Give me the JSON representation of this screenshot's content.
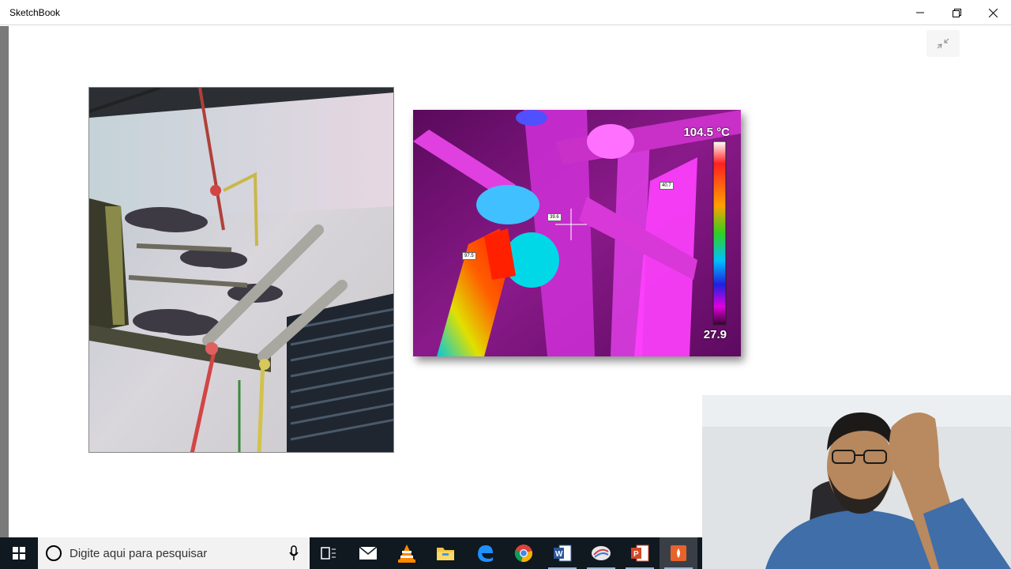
{
  "window": {
    "title": "SketchBook"
  },
  "thermal": {
    "max_label": "104.5 °C",
    "min_label": "27.9",
    "tags": [
      "97.5",
      "39.6",
      "40.7"
    ]
  },
  "taskbar": {
    "search_placeholder": "Digite aqui para pesquisar"
  },
  "icons": {
    "minimize": "minimize-icon",
    "restore": "restore-icon",
    "close": "close-icon",
    "exit_fullscreen": "exit-fullscreen-icon",
    "start": "windows-start-icon",
    "task_view": "task-view-icon",
    "mail": "mail-icon",
    "vlc": "vlc-icon",
    "explorer": "file-explorer-icon",
    "edge": "edge-icon",
    "chrome": "chrome-icon",
    "word": "word-icon",
    "sketchbook": "sketchbook-icon",
    "powerpoint": "powerpoint-icon",
    "recorder": "recorder-icon"
  }
}
